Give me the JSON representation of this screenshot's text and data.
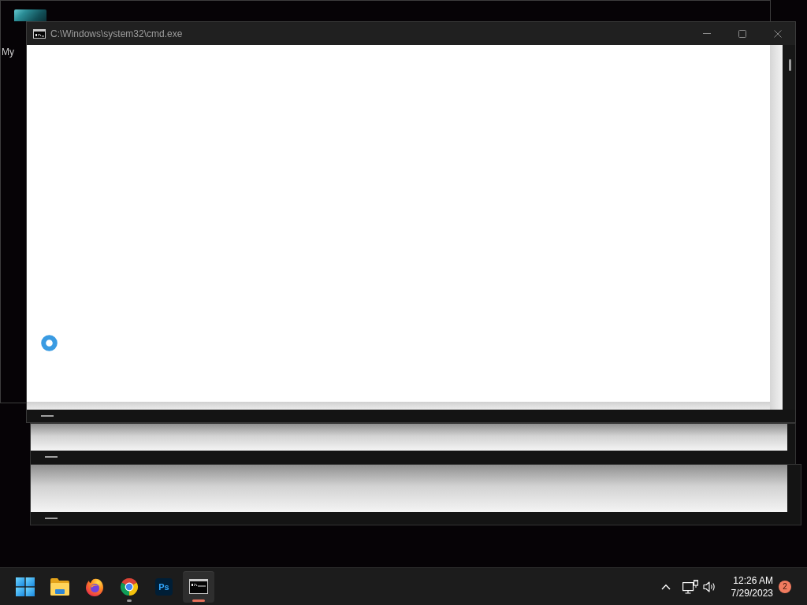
{
  "desktop": {
    "icons": [
      {
        "label": "My"
      }
    ]
  },
  "window": {
    "title": "C:\\Windows\\system32\\cmd.exe",
    "active": false,
    "loading": true
  },
  "taskbar": {
    "apps": [
      {
        "kind": "start",
        "selected": false,
        "running": false
      },
      {
        "kind": "explorer",
        "selected": false,
        "running": false
      },
      {
        "kind": "firefox",
        "selected": false,
        "running": false
      },
      {
        "kind": "chrome",
        "selected": false,
        "running": true
      },
      {
        "kind": "photoshop",
        "label": "Ps",
        "selected": false,
        "running": false
      },
      {
        "kind": "terminal",
        "selected": true,
        "running": true
      }
    ],
    "tray": {
      "time": "12:26 AM",
      "date": "7/29/2023",
      "notification_count": "2"
    }
  }
}
